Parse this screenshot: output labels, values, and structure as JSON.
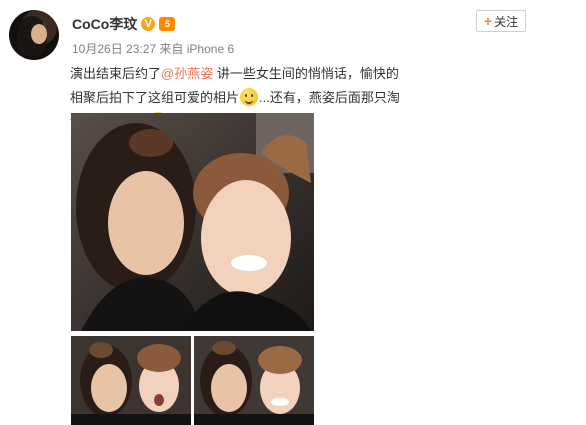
{
  "header": {
    "username": "CoCo李玟",
    "verified_icon": "v-verified-badge",
    "level_icon": "level-badge",
    "level_text": "5",
    "timestamp": "10月26日 23:27",
    "source_prefix": "来自",
    "source": "iPhone 6",
    "follow_plus": "+",
    "follow_label": "关注"
  },
  "post": {
    "text_part1": "演出结束后约了",
    "mention": "@孙燕姿",
    "text_part2": " 讲一些女生间的悄悄话，愉快的相聚后拍下了这组可爱的相片",
    "text_part3": "...还有，燕姿后面那只淘气的手是谁的",
    "emoji_1": "smile-emoji",
    "emoji_2": "doubt-emoji"
  },
  "photos": {
    "count_visible": 3
  },
  "colors": {
    "mention": "#eb7350",
    "follow_plus": "#ff8140",
    "verified": "#f6a623",
    "level": "#ff8a00"
  }
}
